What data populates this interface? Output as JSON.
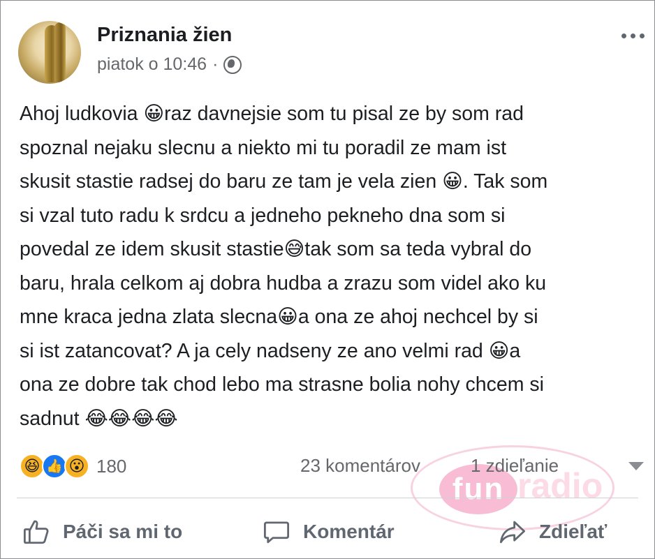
{
  "post": {
    "page_name": "Priznania žien",
    "timestamp": "piatok o 10:46",
    "separator": "·",
    "visibility_icon": "globe-icon",
    "more_icon": "more-options-icon",
    "lines": [
      "Ahoj ludkovia 😀raz davnejsie som tu pisal ze by som rad",
      "spoznal nejaku slecnu a niekto mi tu poradil ze mam ist",
      "skusit stastie radsej do baru ze tam je vela zien 😀. Tak som",
      "si vzal tuto radu k srdcu a jedneho pekneho dna som si",
      "povedal ze idem skusit stastie😅tak som sa teda vybral do",
      "baru, hrala celkom aj dobra hudba a zrazu som videl ako ku",
      "mne kraca jedna zlata slecna😀a ona ze ahoj nechcel by si",
      "si ist zatancovat? A ja cely nadseny ze ano velmi rad 😀a",
      "ona ze dobre tak chod lebo ma strasne bolia nohy chcem si",
      "sadnut 😂😂😂😂"
    ]
  },
  "stats": {
    "reaction_icons": [
      "haha-reaction-icon",
      "like-reaction-icon",
      "wow-reaction-icon"
    ],
    "reactions_count": "180",
    "comments": "23 komentárov",
    "shares": "1 zdieľanie"
  },
  "watermark": {
    "part1": "fun",
    "part2": "radio"
  },
  "actions": {
    "like_label": "Páči sa mi to",
    "comment_label": "Komentár",
    "share_label": "Zdieľať"
  },
  "colors": {
    "text": "#1c1e21",
    "secondary": "#65676b",
    "like_blue": "#1877f2",
    "reaction_yellow": "#f7b125",
    "watermark_pink": "#f6a8c6"
  }
}
